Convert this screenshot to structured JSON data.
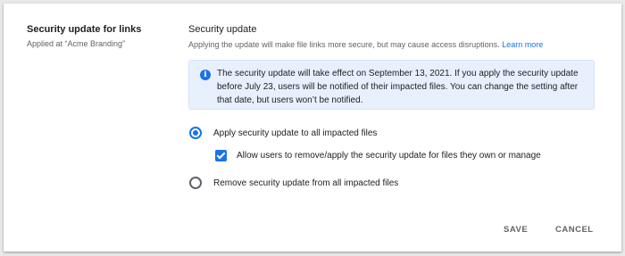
{
  "setting": {
    "title": "Security update for links",
    "applied_at": "Applied at “Acme Branding”"
  },
  "section": {
    "title": "Security update",
    "description": "Applying the update will make file links more secure, but may cause access disruptions.",
    "learn_more": "Learn more"
  },
  "info": {
    "icon": "info-icon",
    "text": "The security update will take effect on September 13, 2021. If you apply the security update before July 23, users will be notified of their impacted files. You can change the setting after that date, but users won’t be notified."
  },
  "options": {
    "apply_all": {
      "label": "Apply security update to all impacted files",
      "selected": true
    },
    "allow_users": {
      "label": "Allow users to remove/apply the security update for files they own or manage",
      "checked": true
    },
    "remove_all": {
      "label": "Remove security update from all impacted files",
      "selected": false
    }
  },
  "actions": {
    "save": "SAVE",
    "cancel": "CANCEL"
  },
  "colors": {
    "accent": "#1a73e8",
    "info_bg": "#e8f0fe"
  }
}
